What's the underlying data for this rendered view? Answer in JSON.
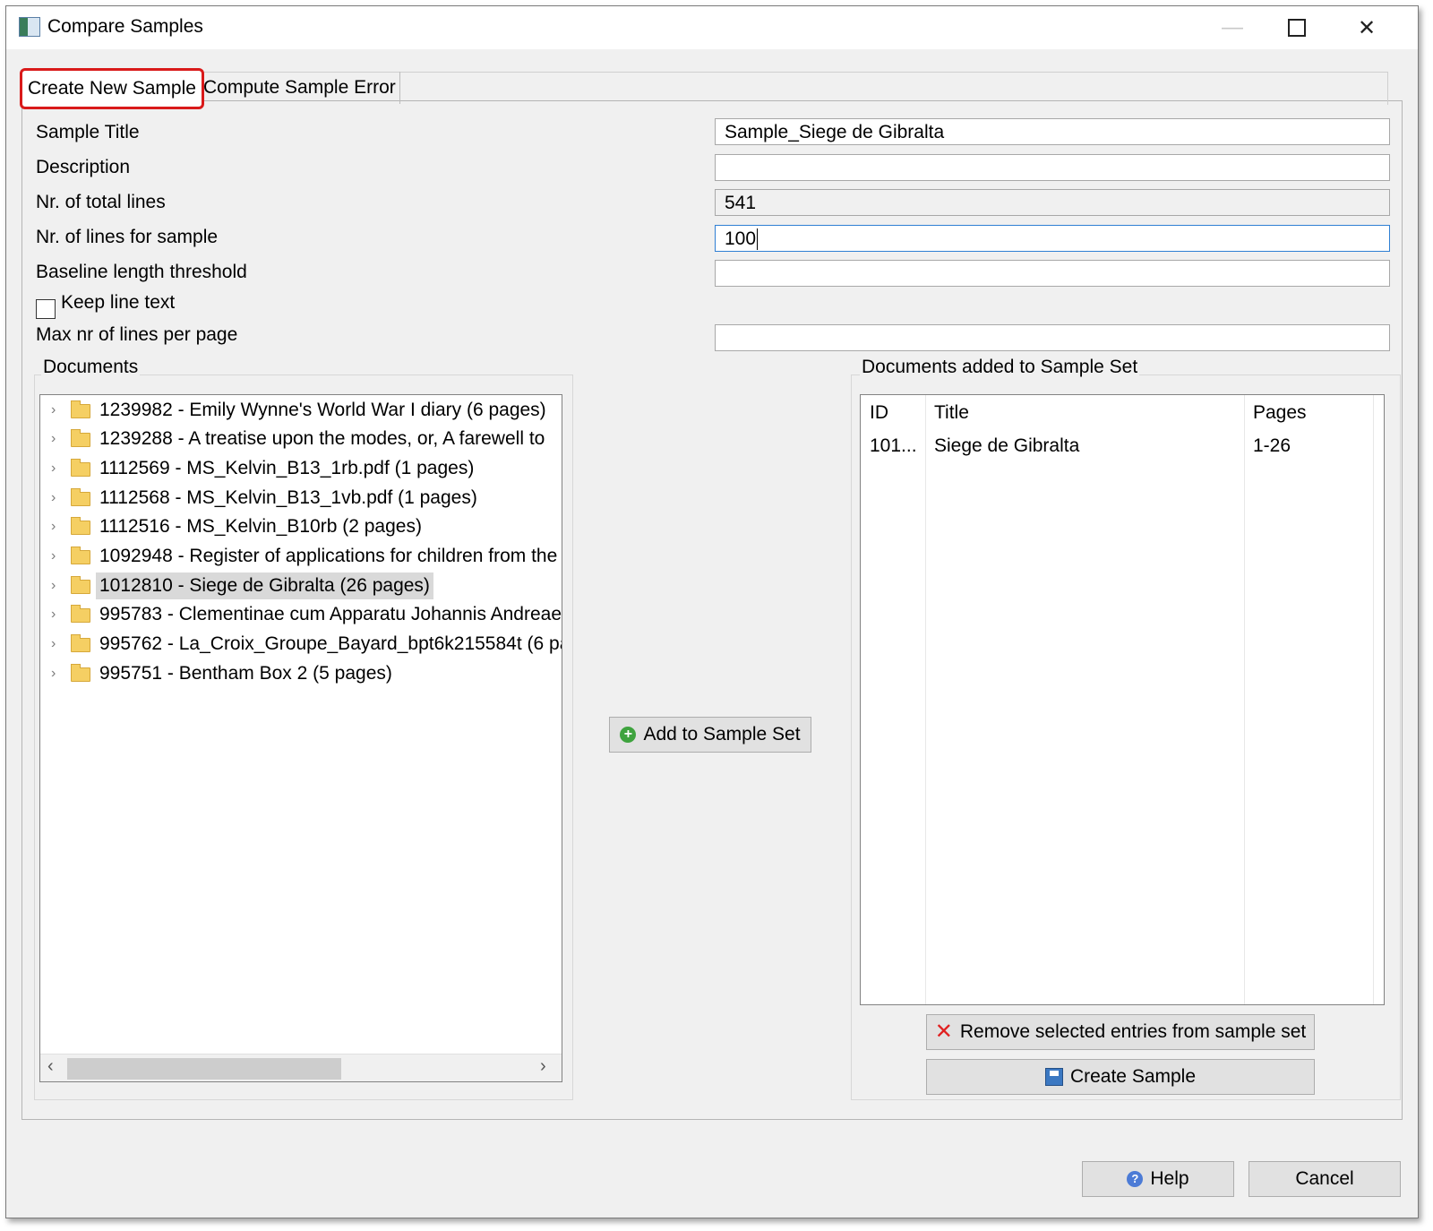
{
  "window": {
    "title": "Compare Samples"
  },
  "tabs": [
    {
      "label": "Create New Sample",
      "active": true
    },
    {
      "label": "Compute Sample Error",
      "active": false
    }
  ],
  "form": {
    "sample_title": {
      "label": "Sample Title",
      "value": "Sample_Siege de Gibralta"
    },
    "description": {
      "label": "Description",
      "value": ""
    },
    "total_lines": {
      "label": "Nr. of total lines",
      "value": "541"
    },
    "lines_for_sample": {
      "label": "Nr. of lines for sample",
      "value": "100"
    },
    "baseline_threshold": {
      "label": "Baseline length threshold",
      "value": ""
    },
    "keep_line_text": {
      "label": "Keep line text",
      "checked": false
    },
    "max_lines_per_page": {
      "label": "Max nr of lines per page",
      "value": ""
    }
  },
  "documents": {
    "title": "Documents",
    "items": [
      {
        "label": "1239982 - Emily Wynne's World War I diary (6 pages)"
      },
      {
        "label": "1239288 - A treatise upon the modes, or, A farewell to"
      },
      {
        "label": "1112569 - MS_Kelvin_B13_1rb.pdf (1 pages)"
      },
      {
        "label": "1112568 - MS_Kelvin_B13_1vb.pdf (1 pages)"
      },
      {
        "label": "1112516 - MS_Kelvin_B10rb (2 pages)"
      },
      {
        "label": "1092948 - Register of applications for children from the"
      },
      {
        "label": "1012810 - Siege de Gibralta (26 pages)",
        "selected": true
      },
      {
        "label": "995783 - Clementinae cum Apparatu Johannis Andreae"
      },
      {
        "label": "995762 - La_Croix_Groupe_Bayard_bpt6k215584t (6 pag"
      },
      {
        "label": "995751 - Bentham Box 2 (5 pages)"
      }
    ]
  },
  "add_button": {
    "label": "Add to Sample Set",
    "icon": "add-icon"
  },
  "sample_set": {
    "title": "Documents added to Sample Set",
    "columns": [
      "ID",
      "Title",
      "Pages"
    ],
    "rows": [
      {
        "id": "101...",
        "title": "Siege de Gibralta",
        "pages": "1-26"
      }
    ]
  },
  "remove_button": {
    "label": "Remove selected entries from sample set",
    "icon": "remove-icon"
  },
  "create_button": {
    "label": "Create Sample",
    "icon": "save-icon"
  },
  "footer": {
    "help_label": "Help",
    "cancel_label": "Cancel"
  }
}
